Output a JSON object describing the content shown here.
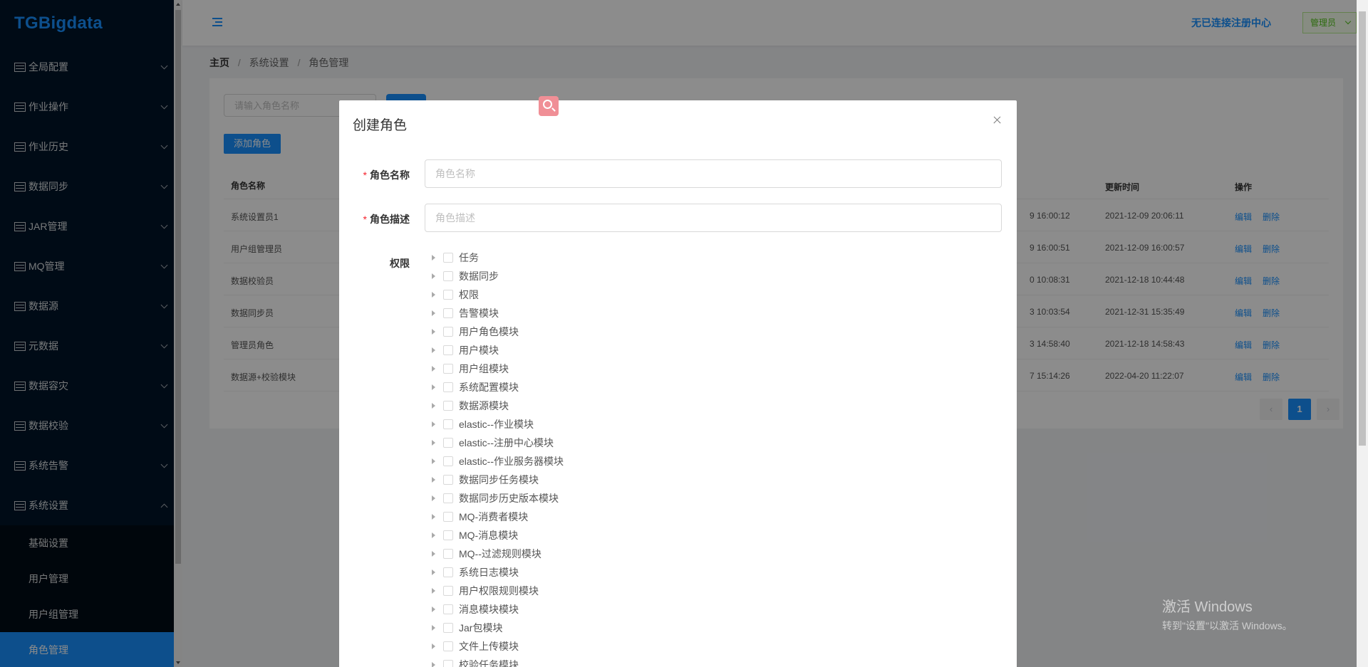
{
  "sidebar": {
    "logo": "TGBigdata",
    "menu": [
      {
        "label": "全局配置"
      },
      {
        "label": "作业操作"
      },
      {
        "label": "作业历史"
      },
      {
        "label": "数据同步"
      },
      {
        "label": "JAR管理"
      },
      {
        "label": "MQ管理"
      },
      {
        "label": "数据源"
      },
      {
        "label": "元数据"
      },
      {
        "label": "数据容灾"
      },
      {
        "label": "数据校验"
      },
      {
        "label": "系统告警"
      },
      {
        "label": "系统设置"
      }
    ],
    "submenu": [
      {
        "label": "基础设置"
      },
      {
        "label": "用户管理"
      },
      {
        "label": "用户组管理"
      },
      {
        "label": "角色管理"
      }
    ]
  },
  "header": {
    "registry_status": "无已连接注册中心",
    "user_role": "管理员"
  },
  "breadcrumb": {
    "home": "主页",
    "level1": "系统设置",
    "level2": "角色管理"
  },
  "card": {
    "search_placeholder": "请输入角色名称",
    "add_button": "添加角色",
    "table": {
      "headers": {
        "name": "角色名称",
        "updated": "更新时间",
        "actions": "操作"
      },
      "rows": [
        {
          "name": "系统设置员1",
          "created_fragment": "9 16:00:12",
          "updated": "2021-12-09 20:06:11"
        },
        {
          "name": "用户组管理员",
          "created_fragment": "9 16:00:51",
          "updated": "2021-12-09 16:00:57"
        },
        {
          "name": "数据校验员",
          "created_fragment": "0 10:08:31",
          "updated": "2021-12-18 10:44:48"
        },
        {
          "name": "数据同步员",
          "created_fragment": "3 10:03:54",
          "updated": "2021-12-31 15:35:49"
        },
        {
          "name": "管理员角色",
          "created_fragment": "3 14:58:40",
          "updated": "2021-12-18 14:58:43"
        },
        {
          "name": "数据源+校验模块",
          "created_fragment": "7 15:14:26",
          "updated": "2022-04-20 11:22:07"
        }
      ],
      "edit_label": "编辑",
      "delete_label": "删除"
    },
    "pagination": {
      "current": "1"
    }
  },
  "modal": {
    "title": "创建角色",
    "fields": {
      "name_label": "角色名称",
      "name_placeholder": "角色名称",
      "desc_label": "角色描述",
      "desc_placeholder": "角色描述",
      "perm_label": "权限"
    },
    "permissions": [
      "任务",
      "数据同步",
      "权限",
      "告警模块",
      "用户角色模块",
      "用户模块",
      "用户组模块",
      "系统配置模块",
      "数据源模块",
      "elastic--作业模块",
      "elastic--注册中心模块",
      "elastic--作业服务器模块",
      "数据同步任务模块",
      "数据同步历史版本模块",
      "MQ-消费者模块",
      "MQ-消息模块",
      "MQ--过滤规则模块",
      "系统日志模块",
      "用户权限规则模块",
      "消息模块模块",
      "Jar包模块",
      "文件上传模块",
      "校验任务模块"
    ]
  },
  "windows_activation": {
    "title": "激活 Windows",
    "subtitle": "转到\"设置\"以激活 Windows。"
  },
  "colors": {
    "sidebar_bg": "#001529",
    "accent": "#1890ff",
    "required": "#f5222d",
    "admin_tag": "#52c41a"
  }
}
